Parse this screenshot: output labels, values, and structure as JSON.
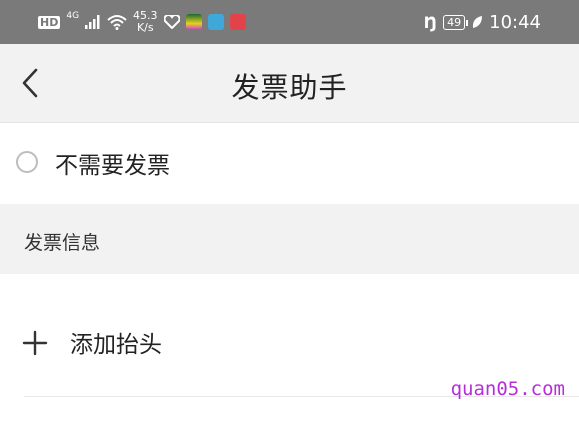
{
  "status_bar": {
    "hd": "HD",
    "network": "4G",
    "speed_value": "45.3",
    "speed_unit": "K/s",
    "battery": "49",
    "time": "10:44",
    "icons": [
      "signal-icon",
      "wifi-icon",
      "heart-app-icon",
      "game-app-icon",
      "book-app-icon",
      "huawei-app-icon",
      "nfc-icon",
      "leaf-icon"
    ]
  },
  "header": {
    "title": "发票助手",
    "back_icon": "chevron-left-icon"
  },
  "no_invoice": {
    "label": "不需要发票",
    "selected": false
  },
  "section": {
    "title": "发票信息"
  },
  "add_header": {
    "label": "添加抬头",
    "icon": "plus-icon"
  },
  "watermark": {
    "text": "quan05.com",
    "color": "#b42fd8"
  }
}
